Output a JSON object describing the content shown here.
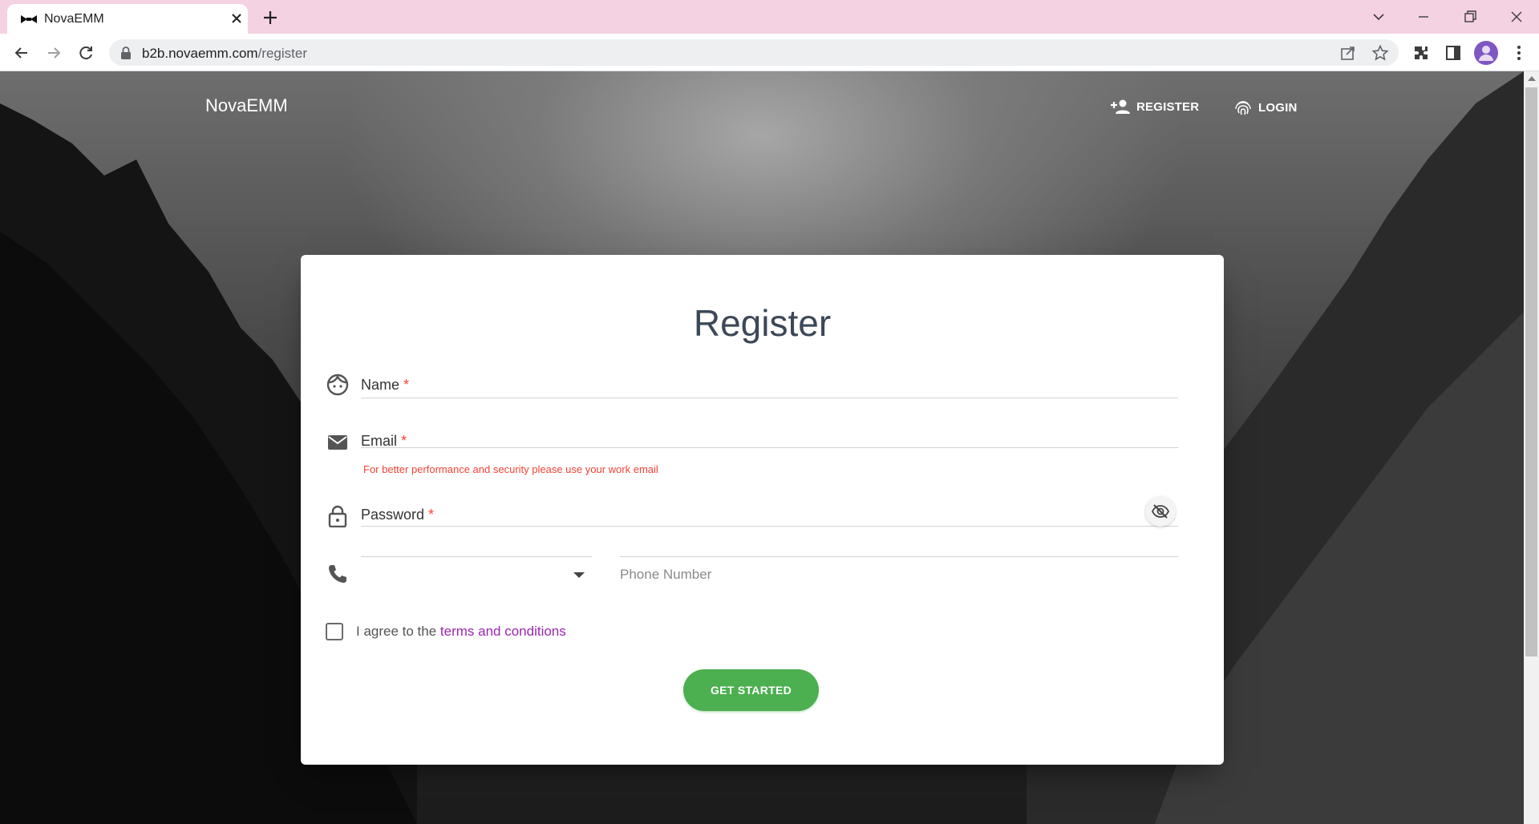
{
  "browser": {
    "tab_title": "NovaEMM",
    "url_host": "b2b.novaemm.com",
    "url_path": "/register"
  },
  "nav": {
    "brand": "NovaEMM",
    "register_label": "REGISTER",
    "login_label": "LOGIN"
  },
  "form": {
    "title": "Register",
    "name_label": "Name",
    "email_label": "Email",
    "email_helper": "For better performance and security please use your work email",
    "password_label": "Password",
    "required_mark": "*",
    "country_value": "",
    "phone_placeholder": "Phone Number",
    "agree_prefix": "I agree to the ",
    "terms_link": "terms and conditions",
    "submit_label": "GET STARTED"
  },
  "colors": {
    "tabbar": "#f4d2e2",
    "accent_green": "#4caf50",
    "link_purple": "#9c27b0",
    "error_red": "#f44336"
  },
  "icons": {
    "name": "face-icon",
    "email": "mail-icon",
    "password": "lock-icon",
    "phone": "phone-icon",
    "visibility": "visibility-off-icon"
  }
}
